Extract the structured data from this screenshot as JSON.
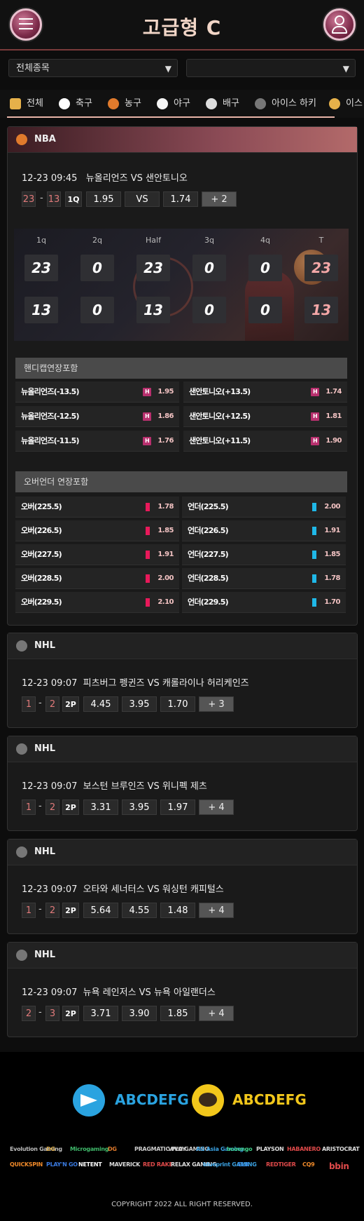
{
  "header": {
    "title": "고급형 C"
  },
  "filters": {
    "sport_select": "전체종목",
    "league_select": ""
  },
  "sports": [
    {
      "label": "전체",
      "color": "#e6b14a"
    },
    {
      "label": "축구",
      "color": "#ffffff"
    },
    {
      "label": "농구",
      "color": "#e07a2c"
    },
    {
      "label": "야구",
      "color": "#f4f4f4"
    },
    {
      "label": "배구",
      "color": "#dddddd"
    },
    {
      "label": "아이스 하키",
      "color": "#777777"
    },
    {
      "label": "이스",
      "color": "#e6b14a"
    }
  ],
  "nba": {
    "league": "NBA",
    "datetime": "12-23 09:45",
    "teams": "뉴올리언즈 VS 샌안토니오",
    "home_score": "23",
    "away_score": "13",
    "period": "1Q",
    "home_odds": "1.95",
    "vs": "VS",
    "away_odds": "1.74",
    "more": "+ 2",
    "board": {
      "labels": [
        "1q",
        "2q",
        "Half",
        "3q",
        "4q",
        "T"
      ],
      "home": [
        "23",
        "0",
        "23",
        "0",
        "0",
        "23"
      ],
      "away": [
        "13",
        "0",
        "13",
        "0",
        "0",
        "13"
      ]
    },
    "handicap_title": "핸디캡연장포함",
    "handicap": [
      {
        "home": "뉴올리언즈(-13.5)",
        "home_odds": "1.95",
        "away": "샌안토니오(+13.5)",
        "away_odds": "1.74"
      },
      {
        "home": "뉴올리언즈(-12.5)",
        "home_odds": "1.86",
        "away": "샌안토니오(+12.5)",
        "away_odds": "1.81"
      },
      {
        "home": "뉴올리언즈(-11.5)",
        "home_odds": "1.76",
        "away": "샌안토니오(+11.5)",
        "away_odds": "1.90"
      }
    ],
    "handicap_badge": "H",
    "ou_title": "오버언더 연장포함",
    "overunder": [
      {
        "over": "오버(225.5)",
        "over_odds": "1.78",
        "under": "언더(225.5)",
        "under_odds": "2.00"
      },
      {
        "over": "오버(226.5)",
        "over_odds": "1.85",
        "under": "언더(226.5)",
        "under_odds": "1.91"
      },
      {
        "over": "오버(227.5)",
        "over_odds": "1.91",
        "under": "언더(227.5)",
        "under_odds": "1.85"
      },
      {
        "over": "오버(228.5)",
        "over_odds": "2.00",
        "under": "언더(228.5)",
        "under_odds": "1.78"
      },
      {
        "over": "오버(229.5)",
        "over_odds": "2.10",
        "under": "언더(229.5)",
        "under_odds": "1.70"
      }
    ],
    "colors": {
      "over": "#e8195a",
      "under": "#1fb8e8"
    }
  },
  "nhl_matches": [
    {
      "league": "NHL",
      "datetime": "12-23 09:07",
      "teams": "피츠버그 펭귄즈 VS 캐롤라이나 허리케인즈",
      "home_score": "1",
      "away_score": "2",
      "period": "2P",
      "odds": [
        "4.45",
        "3.95",
        "1.70"
      ],
      "more": "+ 3"
    },
    {
      "league": "NHL",
      "datetime": "12-23 09:07",
      "teams": "보스턴 브루인즈 VS 위니펙 제츠",
      "home_score": "1",
      "away_score": "2",
      "period": "2P",
      "odds": [
        "3.31",
        "3.95",
        "1.97"
      ],
      "more": "+ 4"
    },
    {
      "league": "NHL",
      "datetime": "12-23 09:07",
      "teams": "오타와 세너터스 VS 워싱턴 캐피털스",
      "home_score": "1",
      "away_score": "2",
      "period": "2P",
      "odds": [
        "5.64",
        "4.55",
        "1.48"
      ],
      "more": "+ 4"
    },
    {
      "league": "NHL",
      "datetime": "12-23 09:07",
      "teams": "뉴욕 레인저스 VS 뉴욕 아일랜더스",
      "home_score": "2",
      "away_score": "3",
      "period": "2P",
      "odds": [
        "3.71",
        "3.90",
        "1.85"
      ],
      "more": "+ 4"
    }
  ],
  "footer": {
    "telegram_id": "ABCDEFG",
    "kakao_id": "ABCDEFG",
    "providers_row1": [
      "Evolution Gaming",
      "DG",
      "Microgaming",
      "DG",
      "PRAGMATIC PLAY",
      "VIVO GAMING",
      "AG Asia Gaming",
      "bcoongo",
      "PLAYSON",
      "HABANERO",
      "ARISTOCRAT"
    ],
    "providers_row2": [
      "QUICKSPIN",
      "PLAY'N GO",
      "NETENT",
      "MAVERICK",
      "RED RAKE",
      "RELAX GAMING",
      "blueprint GAMING",
      "ELK",
      "REDTIGER",
      "CQ9",
      "bbin"
    ],
    "copyright": "COPYRIGHT 2022  ALL RIGHT RESERVED."
  }
}
